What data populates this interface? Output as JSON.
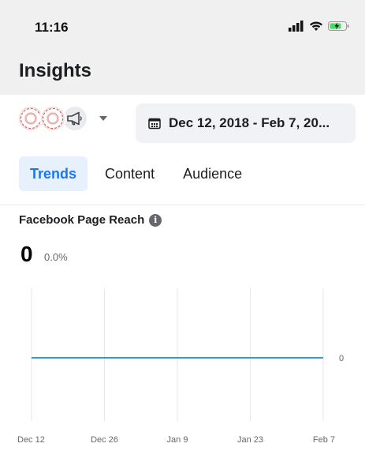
{
  "status_bar": {
    "time": "11:16"
  },
  "header": {
    "title": "Insights"
  },
  "toolbar": {
    "date_range": "Dec 12, 2018 - Feb 7, 20..."
  },
  "tabs": [
    {
      "label": "Trends",
      "active": true
    },
    {
      "label": "Content",
      "active": false
    },
    {
      "label": "Audience",
      "active": false
    }
  ],
  "metric": {
    "title": "Facebook Page Reach",
    "value": "0",
    "change": "0.0%"
  },
  "colors": {
    "accent": "#1877f2",
    "series": "#2d9cdb"
  },
  "chart_data": {
    "type": "line",
    "x": [
      "Dec 12",
      "Dec 26",
      "Jan 9",
      "Jan 23",
      "Feb 7"
    ],
    "series": [
      {
        "values": [
          0,
          0,
          0,
          0,
          0
        ]
      }
    ],
    "y_ticks": [
      "0"
    ],
    "ylim": [
      0,
      0
    ],
    "grid": "vertical"
  }
}
